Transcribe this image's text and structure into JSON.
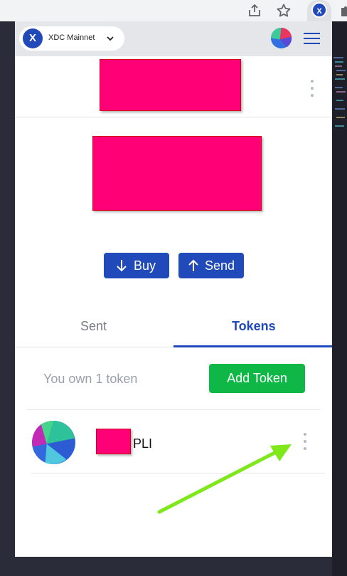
{
  "browser": {
    "share_icon": "share-icon",
    "bookmark_icon": "star-icon",
    "extension_badge": "X",
    "puzzle_icon": "puzzle-icon"
  },
  "header": {
    "network_logo": "X",
    "network_name": "XDC Mainnet",
    "dropdown_icon": "chevron-down-icon",
    "menu_icon": "hamburger-menu-icon"
  },
  "account": {
    "name_redacted": true,
    "balance_redacted": true
  },
  "actions": {
    "buy_label": "Buy",
    "send_label": "Send"
  },
  "tabs": [
    {
      "label": "Sent",
      "active": false
    },
    {
      "label": "Tokens",
      "active": true
    }
  ],
  "tokens_section": {
    "summary": "You own 1 token",
    "add_token_label": "Add Token",
    "items": [
      {
        "symbol": "PLI",
        "amount_redacted": true
      }
    ]
  },
  "colors": {
    "accent": "#2049b9",
    "green": "#0fb846",
    "redaction": "#ff0077",
    "annotation_arrow": "#7ee81a"
  }
}
